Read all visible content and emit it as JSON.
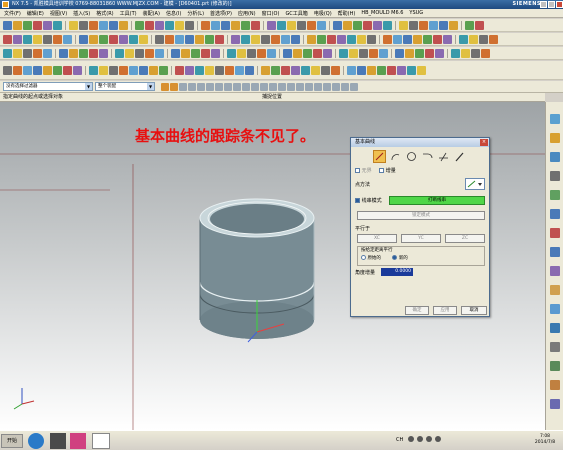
{
  "window": {
    "title": "NX 7.5 - 凯胜模具培训学校  0769-88031860  WWW.MJZX.COM - 建模 - [D60401.prt (修改的)]",
    "brand": "SIEMENS"
  },
  "menu": {
    "items": [
      "文件(F)",
      "编辑(E)",
      "视图(V)",
      "插入(S)",
      "格式(R)",
      "工具(T)",
      "装配(A)",
      "信息(I)",
      "分析(L)",
      "首选项(P)",
      "应用(N)",
      "窗口(O)",
      "GC工具箱",
      "电极(Q)",
      "帮助(H)",
      "HB_MOULD M6.6",
      "YSUG"
    ]
  },
  "selection_bar": {
    "filter": "没有选择过滤器",
    "assembly": "整个装配"
  },
  "cue_line": {
    "prompt": "指定曲线的起点或选择对象",
    "status": "捕捉位置"
  },
  "annotation": {
    "text": "基本曲线的跟踪条不见了。",
    "color": "#e81010"
  },
  "dialog": {
    "title": "基本曲线",
    "close": "×",
    "unbounded_label": "无界",
    "incremental_label": "增量",
    "point_method_label": "点方法",
    "string_mode_label": "线串模式",
    "break_string_label": "打断线串",
    "lock_mode_label": "锁定模式",
    "parallel_label": "平行于",
    "axes": [
      "XC",
      "YC",
      "ZC"
    ],
    "parallel_offset_label": "按给定距离平行",
    "original_label": "原始的",
    "new_label": "新的",
    "angle_increment_label": "角度增量",
    "angle_increment_value": "0.0000",
    "ok_label": "确定",
    "apply_label": "应用",
    "cancel_label": "取消"
  },
  "taskbar": {
    "start_label": "开始",
    "time": "7:08",
    "date": "2014/7/8",
    "ch_label": "CH"
  },
  "colors": {
    "accent": "#2a5c9a",
    "viewport_top": "#9ea3a6",
    "model_body": "#7a8d95",
    "highlight_green": "#4fd648"
  }
}
